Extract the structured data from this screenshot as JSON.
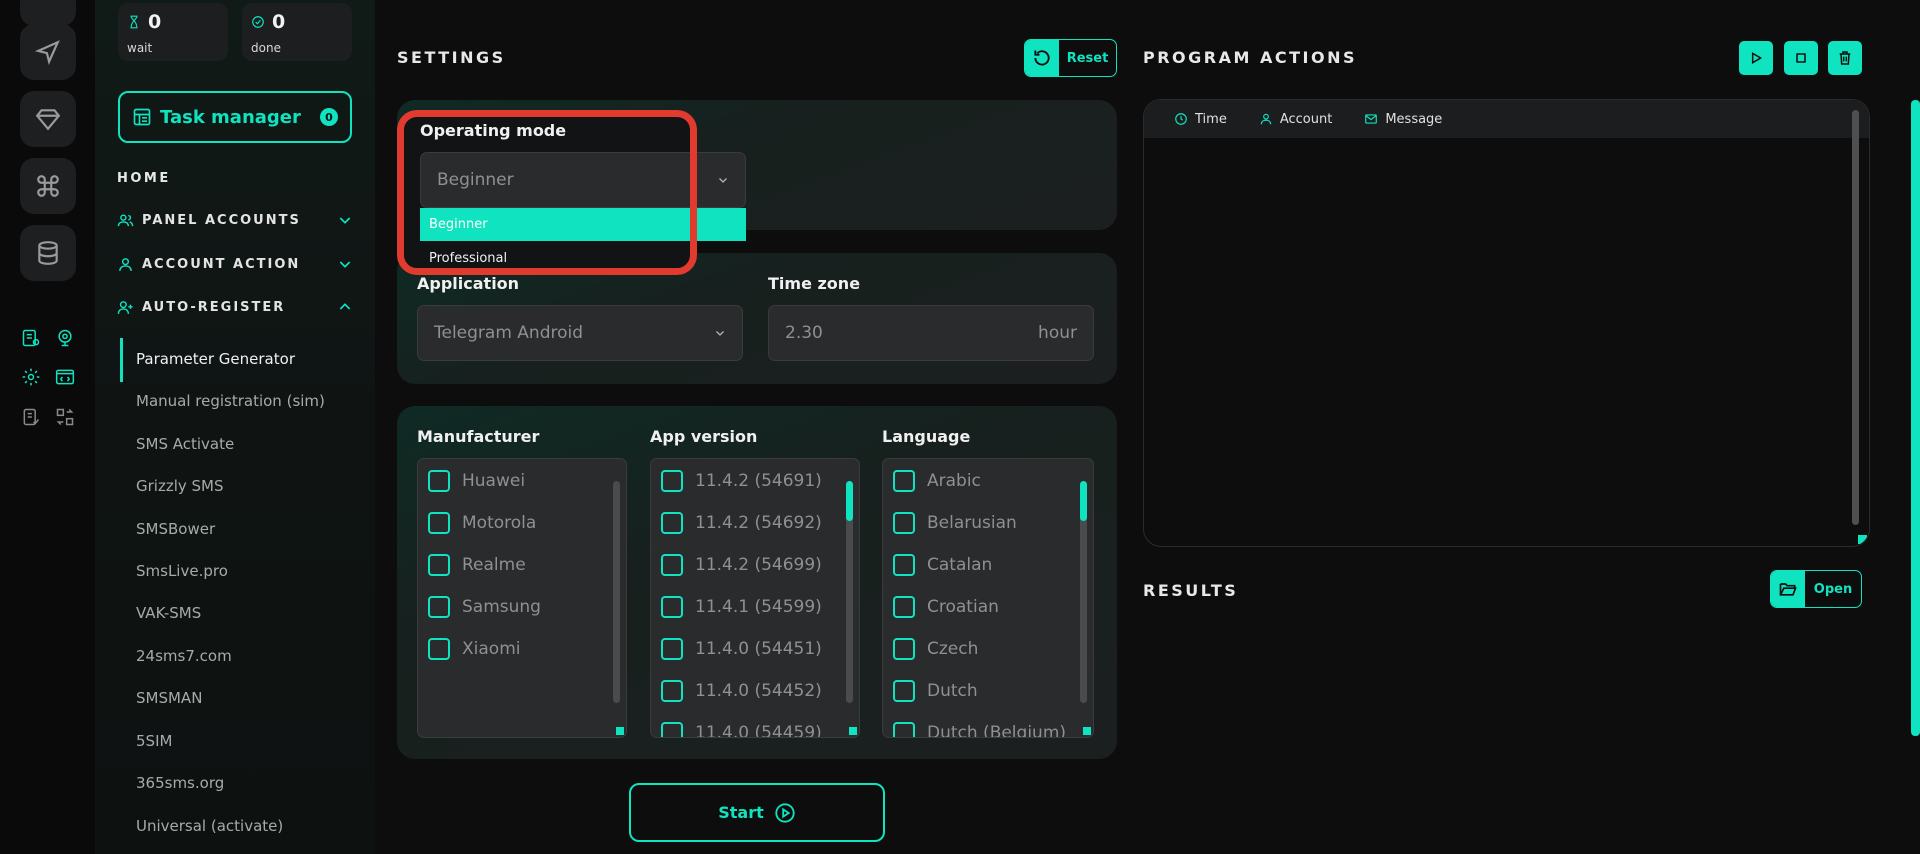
{
  "stats": {
    "wait": {
      "value": "0",
      "label": "wait"
    },
    "done": {
      "value": "0",
      "label": "done"
    }
  },
  "task_manager": {
    "label": "Task manager",
    "count": "0"
  },
  "nav": {
    "home": "HOME",
    "sections": [
      {
        "label": "PANEL ACCOUNTS",
        "icon": "users-icon",
        "expanded": false
      },
      {
        "label": "ACCOUNT ACTION",
        "icon": "user-icon",
        "expanded": false
      },
      {
        "label": "AUTO-REGISTER",
        "icon": "user-plus-icon",
        "expanded": true
      }
    ],
    "sub_items": [
      "Parameter Generator",
      "Manual registration (sim)",
      "SMS Activate",
      "Grizzly SMS",
      "SMSBower",
      "SmsLive.pro",
      "VAK-SMS",
      "24sms7.com",
      "SMSMAN",
      "5SIM",
      "365sms.org",
      "Universal (activate)"
    ],
    "active_sub": "Parameter Generator"
  },
  "settings": {
    "title": "SETTINGS",
    "reset_label": "Reset",
    "operating_mode": {
      "label": "Operating mode",
      "value": "Beginner",
      "options": [
        "Beginner",
        "Professional"
      ],
      "highlighted": "Beginner"
    },
    "application": {
      "label": "Application",
      "value": "Telegram Android"
    },
    "time_zone": {
      "label": "Time zone",
      "value": "2.30",
      "unit": "hour"
    },
    "manufacturer": {
      "label": "Manufacturer",
      "items": [
        "Huawei",
        "Motorola",
        "Realme",
        "Samsung",
        "Xiaomi"
      ]
    },
    "app_version": {
      "label": "App version",
      "items": [
        "11.4.2 (54691)",
        "11.4.2 (54692)",
        "11.4.2 (54699)",
        "11.4.1 (54599)",
        "11.4.0 (54451)",
        "11.4.0 (54452)",
        "11.4.0 (54459)"
      ]
    },
    "language": {
      "label": "Language",
      "items": [
        "Arabic",
        "Belarusian",
        "Catalan",
        "Croatian",
        "Czech",
        "Dutch",
        "Dutch (Belgium)"
      ]
    },
    "start_label": "Start"
  },
  "program_actions": {
    "title": "PROGRAM ACTIONS",
    "columns": [
      "Time",
      "Account",
      "Message"
    ]
  },
  "results": {
    "title": "RESULTS",
    "open_label": "Open"
  },
  "colors": {
    "accent": "#0fe3c0",
    "highlight_frame": "#e13a2e",
    "background": "#0d0d0e"
  }
}
